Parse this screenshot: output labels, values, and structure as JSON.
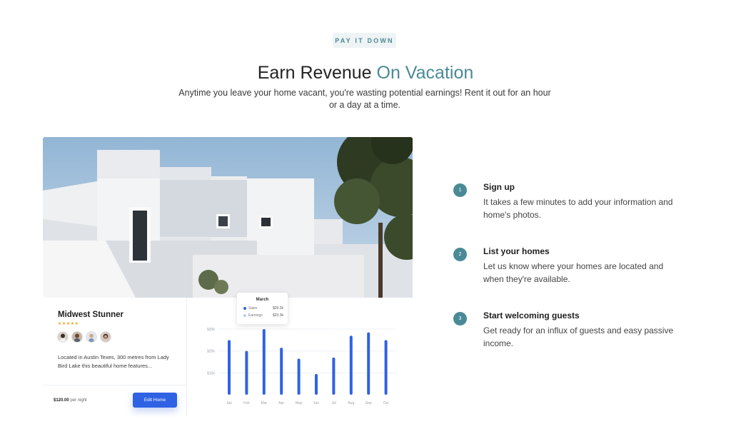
{
  "section": {
    "eyebrow": "PAY IT DOWN",
    "headline_plain": "Earn Revenue ",
    "headline_accent": "On Vacation",
    "subtitle": "Anytime you leave your home vacant, you're wasting potential earnings! Rent it out for an hour or a day at a time.",
    "accent_color": "#4a8a96"
  },
  "listing_card": {
    "title": "Midwest Stunner",
    "stars": "★★★★★",
    "rating": 5,
    "description": "Located in Austin Texes, 300 metres from Lady Bird Lake this beautiful home features...",
    "price": "$120.00",
    "price_unit": "per night",
    "button_label": "Edit Home",
    "button_color": "#2f62e3"
  },
  "tooltip": {
    "title": "March",
    "rows": [
      {
        "label": "Sales",
        "value": "$29.2k",
        "color": "#2f62e3"
      },
      {
        "label": "Earnings",
        "value": "$23.3k",
        "color": "#b9cdf5"
      }
    ]
  },
  "chart_data": {
    "type": "bar",
    "categories": [
      "Jan",
      "Feb",
      "Mar",
      "Apr",
      "May",
      "Jun",
      "Jul",
      "Aug",
      "Sep",
      "Oct"
    ],
    "y_tick_labels": [
      "$30k",
      "$20k",
      "$10k"
    ],
    "y_ticks": [
      30,
      20,
      10
    ],
    "ylim": [
      0,
      30
    ],
    "series": [
      {
        "name": "Sales",
        "values": [
          25,
          20,
          30,
          21.5,
          16.5,
          9.5,
          17,
          27,
          28.5,
          25
        ],
        "color": "#2f62e3"
      }
    ],
    "grid": true
  },
  "steps": [
    {
      "number": "1",
      "title": "Sign up",
      "description": "It takes a few minutes to add your information and home's photos."
    },
    {
      "number": "2",
      "title": "List your homes",
      "description": "Let us know where your homes are located and when they're available."
    },
    {
      "number": "3",
      "title": "Start welcoming guests",
      "description": "Get ready for an influx of guests and easy passive income."
    }
  ]
}
